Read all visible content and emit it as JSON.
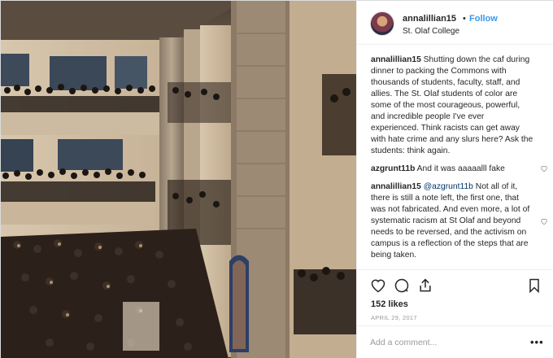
{
  "post": {
    "username": "annalillian15",
    "follow_label": "Follow",
    "separator": "•",
    "location": "St. Olaf College",
    "comments": [
      {
        "user": "annalillian15",
        "text": " Shutting down the caf during dinner to packing the Commons with thousands of students, faculty, staff, and allies. The St. Olaf students of color are some of the most courageous, powerful, and incredible people I've ever experienced. Think racists can get away with hate crime and any slurs here? Ask the students: think again.",
        "mention": ""
      },
      {
        "user": "azgrunt11b",
        "text": " And it was aaaaalll fake",
        "mention": ""
      },
      {
        "user": "annalillian15",
        "mention": "@azgrunt11b",
        "text": " Not all of it, there is still a note left, the first one, that was not fabricated. And even more, a lot of systematic racism at St Olaf and beyond needs to be reversed, and the activism on campus is a reflection of the steps that are being taken."
      }
    ],
    "likes": "152 likes",
    "date": "April 29, 2017",
    "add_comment_placeholder": "Add a comment...",
    "more_label": "•••"
  },
  "icons": [
    "heart-icon",
    "comment-icon",
    "share-icon",
    "bookmark-icon",
    "like-comment-icon",
    "more-options-icon"
  ],
  "colors": {
    "follow": "#3897f0",
    "border": "#efefef",
    "muted": "#999999",
    "text": "#262626"
  }
}
